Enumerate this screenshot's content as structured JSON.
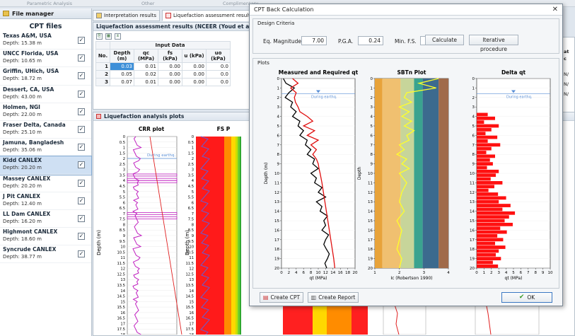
{
  "top_strip": [
    "Parametric Analysis",
    "Other",
    "Complimentary"
  ],
  "file_manager": {
    "header": "File manager",
    "title": "CPT files",
    "files": [
      {
        "name": "Texas A&M, USA",
        "depth": "Depth: 15.38 m",
        "checked": true
      },
      {
        "name": "UNCC Florida, USA",
        "depth": "Depth: 10.65 m",
        "checked": true
      },
      {
        "name": "Griffin, UHich, USA",
        "depth": "Depth: 18.72 m",
        "checked": true
      },
      {
        "name": "Dessert, CA, USA",
        "depth": "Depth: 43.00 m",
        "checked": true
      },
      {
        "name": "Holmen, NGI",
        "depth": "Depth: 22.00 m",
        "checked": true
      },
      {
        "name": "Fraser Delta, Canada",
        "depth": "Depth: 25.10 m",
        "checked": true
      },
      {
        "name": "Jamuna, Bangladesh",
        "depth": "Depth: 35.06 m",
        "checked": true
      },
      {
        "name": "Kidd CANLEX",
        "depth": "Depth: 20.20 m",
        "checked": true,
        "selected": true
      },
      {
        "name": "Massey CANLEX",
        "depth": "Depth: 20.20 m",
        "checked": true
      },
      {
        "name": "J Pit CANLEX",
        "depth": "Depth: 12.40 m",
        "checked": true
      },
      {
        "name": "LL Dam CANLEX",
        "depth": "Depth: 16.20 m",
        "checked": true
      },
      {
        "name": "Highmont CANLEX",
        "depth": "Depth: 18.60 m",
        "checked": true
      },
      {
        "name": "Syncrude CANLEX",
        "depth": "Depth: 38.77 m",
        "checked": true
      }
    ]
  },
  "tabs": [
    "Interpretation results",
    "Liquefaction assessment results"
  ],
  "results_panel": {
    "title": "Liquefaction assessment results (NCEER (Youd et al 2001))",
    "input_data_header": "Input Data",
    "columns": [
      "No.",
      "Depth (m)",
      "qc (MPa)",
      "fs (kPa)",
      "u (kPa)",
      "uo (kPa)"
    ],
    "rows": [
      [
        "1",
        "0.03",
        "0.01",
        "0.00",
        "0.00",
        "0.0"
      ],
      [
        "2",
        "0.05",
        "0.02",
        "0.00",
        "0.00",
        "0.0"
      ],
      [
        "3",
        "0.07",
        "0.01",
        "0.00",
        "0.00",
        "0.0"
      ]
    ]
  },
  "right_stub": {
    "header": "at",
    "c": "c",
    "n1": "N/",
    "n2": "N/",
    "n3": "N/"
  },
  "analysis_panel": {
    "title": "Liquefaction analysis plots",
    "crr_title": "CRR plot",
    "fs_title": "FS P",
    "depth_label": "Depth (m)",
    "during_label": "During earthq."
  },
  "dialog": {
    "title": "CPT Back Calculation",
    "design_criteria": "Design Criteria",
    "eq_label": "Eq. Magnitude",
    "eq_value": "7.00",
    "pga_label": "P.G.A.",
    "pga_value": "0.24",
    "minfs_label": "Min. F.S.",
    "minfs_value": "1.20",
    "calculate": "Calculate",
    "iterative": "Iterative procedure",
    "plots": "Plots",
    "create_cpt": "Create CPT",
    "create_report": "Create Report",
    "ok": "OK",
    "close_glyph": "✕"
  },
  "chart_data": [
    {
      "type": "line",
      "title": "Measured and Required qt",
      "xlabel": "qt (MPa)",
      "ylabel": "Depth (m)",
      "xlim": [
        0,
        20
      ],
      "ylim": [
        20,
        0
      ],
      "x_ticks": [
        "0",
        "2",
        "4",
        "6",
        "8",
        "10",
        "12",
        "14",
        "16",
        "18",
        "20"
      ],
      "y_ticks": [
        "0",
        "1",
        "2",
        "3",
        "4",
        "5",
        "6",
        "7",
        "8",
        "9",
        "10",
        "11",
        "12",
        "13",
        "14",
        "15",
        "16",
        "17",
        "18",
        "19",
        "20"
      ],
      "water_level_depth": 1.6,
      "annotation": "During earthq.",
      "series": [
        {
          "color": "#000000",
          "depth": [
            0,
            0.5,
            1,
            1.5,
            2,
            2.5,
            3,
            3.5,
            4,
            4.5,
            5,
            5.5,
            6,
            6.5,
            7,
            7.5,
            8,
            8.5,
            9,
            9.5,
            10,
            10.5,
            11,
            11.5,
            12,
            12.5,
            13,
            13.5,
            14,
            14.5,
            15,
            15.5,
            16,
            16.5,
            17,
            17.5,
            18,
            18.5,
            19,
            19.5,
            20
          ],
          "qt": [
            0.5,
            1.2,
            3.5,
            2,
            1,
            3,
            2.5,
            4,
            3,
            5,
            4.5,
            6,
            5,
            7,
            6.5,
            8,
            7,
            9,
            8.5,
            10,
            8,
            9.5,
            9,
            11,
            10,
            12,
            9.5,
            11,
            10.5,
            12.5,
            11.5,
            12,
            11,
            12.8,
            12,
            11.5,
            12.2,
            13,
            12.5,
            11.8,
            12.3
          ]
        },
        {
          "color": "#e01010",
          "depth": [
            0,
            0.5,
            1,
            1.5,
            2,
            2.5,
            3,
            3.5,
            4,
            4.5,
            5,
            5.5,
            6,
            6.5,
            7,
            7.5,
            8,
            8.5,
            9,
            9.5,
            10,
            11,
            12,
            13,
            14,
            15,
            16,
            17,
            18,
            19,
            20
          ],
          "qt": [
            3,
            4.5,
            2.5,
            4,
            3.5,
            3.8,
            4.5,
            5,
            7,
            8.5,
            6,
            9,
            7,
            10,
            8,
            9.5,
            8.5,
            9.5,
            10,
            10.2,
            10.5,
            11,
            11.4,
            11.8,
            12.2,
            12.6,
            13,
            13.4,
            13.8,
            14.2,
            14.5
          ]
        }
      ]
    },
    {
      "type": "line",
      "title": "SBTn Plot",
      "xlabel": "Ic (Robertson 1990)",
      "ylabel": "Depth",
      "xlim": [
        1,
        4
      ],
      "ylim": [
        20,
        0
      ],
      "x_ticks": [
        "1",
        "2",
        "3",
        "4"
      ],
      "y_ticks": [
        "0",
        "1",
        "2",
        "3",
        "4",
        "5",
        "6",
        "7",
        "8",
        "9",
        "10",
        "11",
        "12",
        "13",
        "14",
        "15",
        "16",
        "17",
        "18",
        "19",
        "20"
      ],
      "zone_bounds": [
        1,
        1.31,
        2.05,
        2.6,
        2.95,
        3.6,
        4
      ],
      "zone_colors": [
        "#e8a33a",
        "#f0c070",
        "#c7d59a",
        "#3aa38f",
        "#3c6a8e",
        "#a06a4a"
      ],
      "series": [
        {
          "color": "#ffff2a",
          "depth": [
            0,
            0.5,
            1,
            1.5,
            2,
            2.5,
            3,
            3.5,
            4,
            4.5,
            5,
            5.5,
            6,
            6.5,
            7,
            7.5,
            8,
            8.5,
            9,
            9.5,
            10,
            11,
            12,
            13,
            14,
            15,
            16,
            17,
            18,
            19,
            20
          ],
          "ic": [
            3.6,
            2.8,
            3.5,
            2.3,
            2.2,
            2.5,
            2,
            2.4,
            2.1,
            2.5,
            2.2,
            2.6,
            2.3,
            2.4,
            2,
            2.2,
            1.9,
            2.3,
            2.1,
            2.4,
            2,
            2.3,
            2.1,
            2,
            2.2,
            1.9,
            2.1,
            2,
            1.9,
            2.1,
            2
          ]
        }
      ]
    },
    {
      "type": "bar",
      "title": "Delta qt",
      "xlabel": "qt (MPa)",
      "ylabel": "",
      "xlim": [
        0,
        10
      ],
      "ylim": [
        20,
        0
      ],
      "x_ticks": [
        "0",
        "1",
        "2",
        "3",
        "4",
        "5",
        "6",
        "7",
        "8",
        "9",
        "10"
      ],
      "y_ticks": [
        "0",
        "1",
        "2",
        "3",
        "4",
        "5",
        "6",
        "7",
        "8",
        "9",
        "10",
        "11",
        "12",
        "13",
        "14",
        "15",
        "16",
        "17",
        "18",
        "19",
        "20"
      ],
      "annotation": "During earthq.",
      "depth": [
        3.8,
        4.2,
        4.6,
        5,
        5.4,
        5.8,
        6.2,
        6.6,
        7,
        7.4,
        7.8,
        8.2,
        8.6,
        9,
        9.4,
        9.8,
        10.2,
        10.6,
        11,
        11.4,
        11.8,
        12.2,
        12.6,
        13,
        13.4,
        13.8,
        14.2,
        14.6,
        15,
        15.4,
        15.8,
        16.2,
        16.6,
        17,
        17.4,
        17.8,
        18.2,
        18.6,
        19,
        19.4,
        19.8
      ],
      "values": [
        1.5,
        2.5,
        1,
        3,
        2,
        1.2,
        2.8,
        1.5,
        3.2,
        2,
        1.3,
        2.5,
        1.8,
        2.2,
        1.4,
        3,
        2.6,
        1.9,
        3.5,
        2.4,
        1.6,
        2.9,
        4,
        3,
        4.6,
        3.5,
        5.2,
        4.4,
        3.8,
        4.9,
        3.2,
        4.1,
        2.8,
        3.6,
        2.5,
        3.9,
        3,
        2.6,
        3.3,
        2.2,
        2.9
      ]
    }
  ]
}
